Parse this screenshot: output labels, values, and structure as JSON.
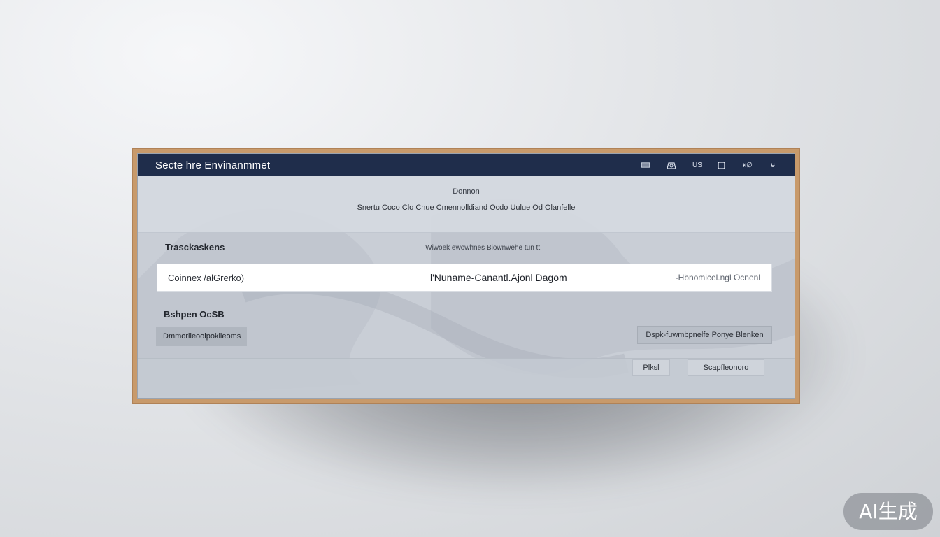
{
  "window": {
    "title": "Secte hre  Envinanmmet",
    "titlebar_icons": [
      {
        "name": "minimize-icon",
        "glyph": ""
      },
      {
        "name": "cloud-icon",
        "glyph": ""
      },
      {
        "name": "usb-label",
        "glyph": "US"
      },
      {
        "name": "square-icon",
        "glyph": ""
      },
      {
        "name": "menu-label",
        "glyph": "ᴋ∅"
      },
      {
        "name": "close-label",
        "glyph": "ᵾ"
      }
    ]
  },
  "header": {
    "heading": "Donnon",
    "subheading": "Snertu Coco Clo Cnue Cmennolldiand Ocdo Uulue Od Olanfelle"
  },
  "section": {
    "label": "Trasckaskens",
    "description": "Wiwoek ewowhnes Biownwehe tun ttı"
  },
  "input_row": {
    "left": "Coinnex /alGrerko)",
    "middle": "l'Nuname-Canantl.Ajonl Dagom",
    "right": "-Hbnomicel.ngl Ocnenl"
  },
  "options": {
    "label": "Bshpen OcSB",
    "field_value": "Dmmoriieooipokiieoms",
    "button_label": "Dspk-fuwmbpnelfe Ponye Blenken"
  },
  "footer": {
    "ok_label": "Plksl",
    "cancel_label": "Scapfleonoro"
  },
  "watermark": {
    "text": "AI生成"
  },
  "colors": {
    "titlebar": "#1f2d4b",
    "frame": "#c89a6b",
    "panel": "#c9ced6"
  }
}
